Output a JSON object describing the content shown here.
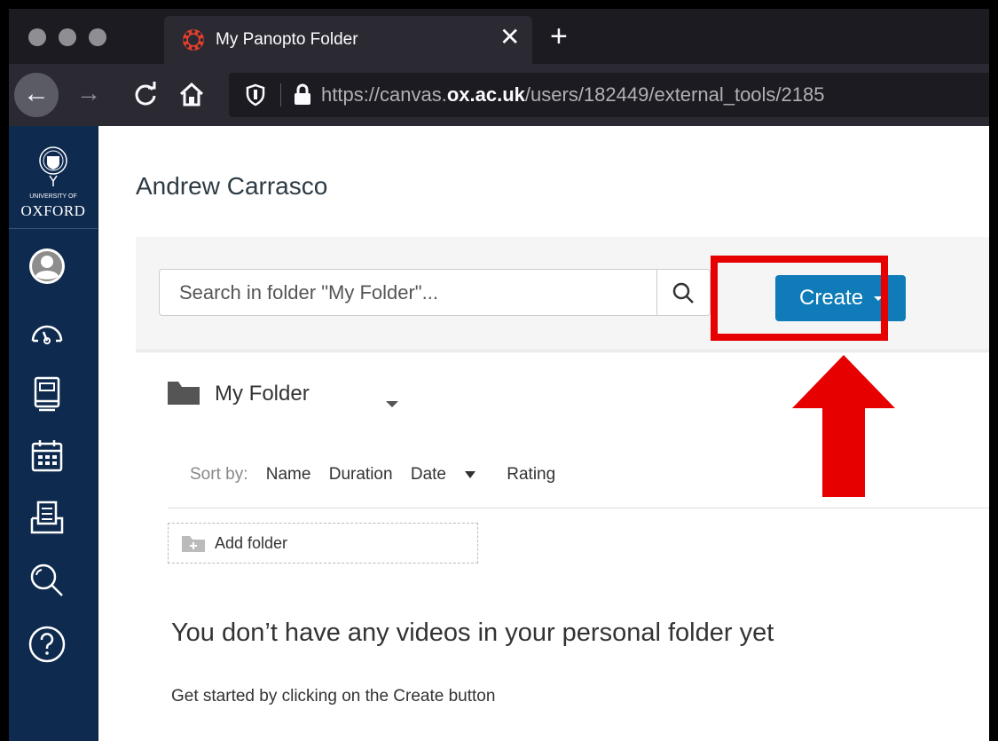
{
  "browser": {
    "tab_title": "My Panopto Folder",
    "tab_close": "✕",
    "new_tab": "+",
    "url_prefix": "https://canvas.",
    "url_domain": "ox.ac.uk",
    "url_path": "/users/182449/external_tools/2185"
  },
  "sidebar": {
    "logo_small": "UNIVERSITY OF",
    "logo_big": "OXFORD",
    "items": [
      {
        "icon": "account-icon"
      },
      {
        "icon": "dashboard-icon"
      },
      {
        "icon": "courses-icon"
      },
      {
        "icon": "calendar-icon"
      },
      {
        "icon": "inbox-icon"
      },
      {
        "icon": "search-icon"
      },
      {
        "icon": "help-icon"
      }
    ]
  },
  "main": {
    "user_name": "Andrew Carrasco",
    "search_placeholder": "Search in folder \"My Folder\"...",
    "create_label": "Create",
    "folder_name": "My Folder",
    "sort": {
      "label": "Sort by:",
      "options": [
        "Name",
        "Duration",
        "Date",
        "Rating"
      ]
    },
    "add_folder_label": "Add folder",
    "empty_heading": "You don’t have any videos in your personal folder yet",
    "empty_sub": "Get started by clicking on the Create button"
  },
  "colors": {
    "sidebar_bg": "#0e2a4f",
    "create_button": "#0f7bb8",
    "highlight": "#e60000"
  }
}
